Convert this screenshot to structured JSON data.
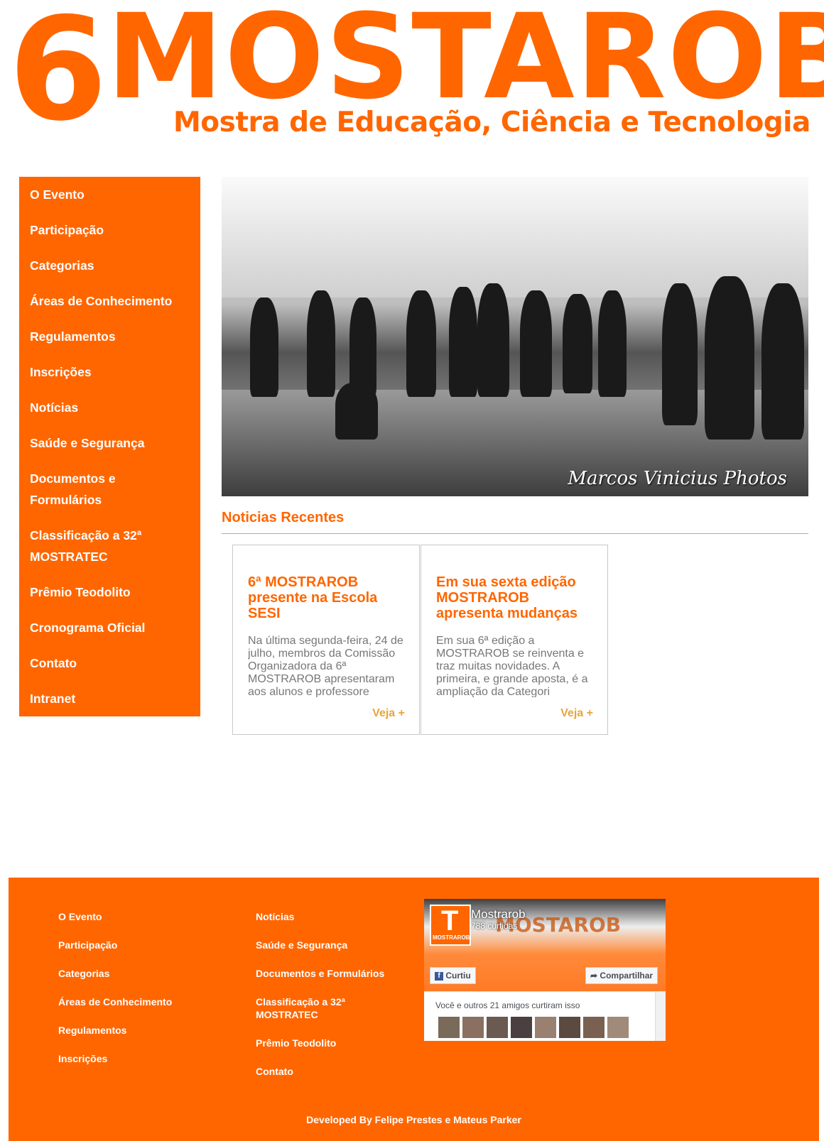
{
  "header": {
    "logo_number": "6",
    "logo_word": "MOSTAROB",
    "subtitle": "Mostra de Educação, Ciência e Tecnologia"
  },
  "sidebar": {
    "items": [
      {
        "label": "O Evento"
      },
      {
        "label": "Participação"
      },
      {
        "label": "Categorias"
      },
      {
        "label": "Áreas de Conhecimento"
      },
      {
        "label": "Regulamentos"
      },
      {
        "label": "Inscrições"
      },
      {
        "label": "Notícias"
      },
      {
        "label": "Saúde e Segurança"
      },
      {
        "label": "Documentos e Formulários"
      },
      {
        "label": "Classificação a 32ª MOSTRATEC"
      },
      {
        "label": "Prêmio Teodolito"
      },
      {
        "label": "Cronograma Oficial"
      },
      {
        "label": "Contato"
      },
      {
        "label": "Intranet"
      }
    ]
  },
  "hero": {
    "photo_credit": "Marcos Vinicius Photos"
  },
  "news": {
    "section_title": "Noticias Recentes",
    "cards": [
      {
        "title": "6ª MOSTRAROB presente na Escola SESI",
        "excerpt": "Na última segunda-feira, 24 de julho, membros da Comissão Organizadora da 6ª MOSTRAROB apresentaram aos alunos e professore",
        "more_label": "Veja +"
      },
      {
        "title": "Em sua sexta edição MOSTRAROB apresenta mudanças",
        "excerpt": "Em sua 6ª edição a MOSTRAROB se reinventa e traz muitas novidades. A primeira, e grande aposta, é a ampliação da Categori",
        "more_label": "Veja +"
      }
    ]
  },
  "footer": {
    "col1": [
      {
        "label": "O Evento"
      },
      {
        "label": "Participação"
      },
      {
        "label": "Categorias"
      },
      {
        "label": "Áreas de Conhecimento"
      },
      {
        "label": "Regulamentos"
      },
      {
        "label": "Inscrições"
      }
    ],
    "col2": [
      {
        "label": "Notícias"
      },
      {
        "label": "Saúde e Segurança"
      },
      {
        "label": "Documentos e Formulários"
      },
      {
        "label": "Classificação a 32ª MOSTRATEC"
      },
      {
        "label": "Prêmio Teodolito"
      },
      {
        "label": "Contato"
      }
    ],
    "facebook": {
      "page_name": "Mostrarob",
      "likes": "788 curtidas",
      "avatar_label": "MOSTRAROB",
      "banner_text": "MOSTAROB",
      "like_button": "Curtiu",
      "share_button": "Compartilhar",
      "friends_text": "Você e outros 21 amigos curtiram isso"
    },
    "credits": "Developed By Felipe Prestes e Mateus Parker"
  },
  "colors": {
    "brand": "#ff6600",
    "accent": "#e8a53a",
    "text_muted": "#777777"
  }
}
